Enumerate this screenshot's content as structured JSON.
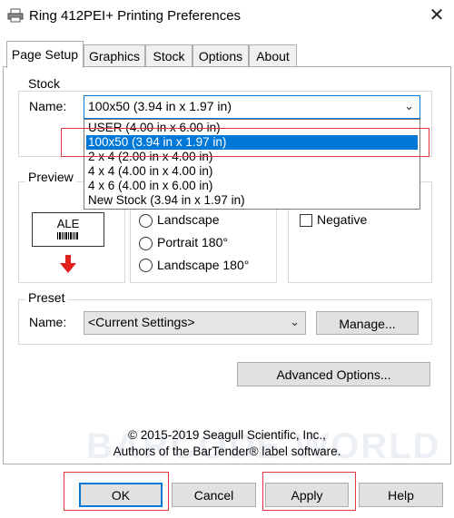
{
  "window": {
    "title": "Ring 412PEI+ Printing Preferences",
    "close_glyph": "✕"
  },
  "tabs": [
    {
      "label": "Page Setup",
      "active": true
    },
    {
      "label": "Graphics"
    },
    {
      "label": "Stock"
    },
    {
      "label": "Options"
    },
    {
      "label": "About"
    }
  ],
  "stock": {
    "group_label": "Stock",
    "name_label": "Name:",
    "selected": "100x50 (3.94 in x 1.97 in)",
    "options": [
      "USER (4.00 in x 6.00 in)",
      "100x50 (3.94 in x 1.97 in)",
      "2 x 4 (2.00 in x 4.00 in)",
      "4 x 4 (4.00 in x 4.00 in)",
      "4 x 6 (4.00 in x 6.00 in)",
      "New Stock (3.94 in x 1.97 in)"
    ]
  },
  "preview": {
    "group_label": "Preview",
    "label_text": "ALE",
    "arrow_color": "#e3211c"
  },
  "orientation": {
    "options": [
      "Landscape",
      "Portrait 180°",
      "Landscape 180°"
    ]
  },
  "effects": {
    "negative_label": "Negative"
  },
  "preset": {
    "group_label": "Preset",
    "name_label": "Name:",
    "value": "<Current Settings>",
    "manage_button": "Manage..."
  },
  "advanced_button": "Advanced Options...",
  "copyright": {
    "line1": "© 2015-2019 Seagull Scientific, Inc.,",
    "line2": "Authors of the BarTender® label software."
  },
  "buttons": {
    "ok": "OK",
    "cancel": "Cancel",
    "apply": "Apply",
    "help": "Help"
  },
  "watermark": "BARCODE WORLD",
  "colors": {
    "accent": "#0078d7",
    "highlight_box": "#d9363e"
  }
}
